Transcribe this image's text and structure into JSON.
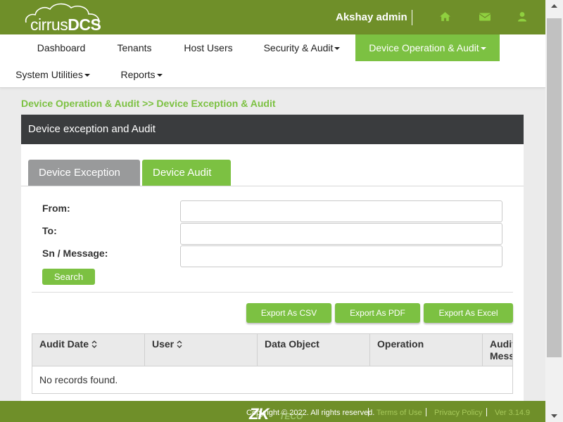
{
  "header": {
    "logo_light": "cirrus",
    "logo_bold": "DCS",
    "user_name": "Akshay admin",
    "icons": [
      "home-icon",
      "envelope-icon",
      "user-icon"
    ]
  },
  "nav": {
    "items": [
      {
        "label": "Dashboard"
      },
      {
        "label": "Tenants"
      },
      {
        "label": "Host Users"
      },
      {
        "label": "Security & Audit"
      },
      {
        "label": "Device Operation & Audit"
      },
      {
        "label": "System Utilities"
      },
      {
        "label": "Reports"
      }
    ],
    "active": "Device Operation & Audit"
  },
  "breadcrumb": "Device Operation & Audit >> Device Exception & Audit",
  "panel": {
    "title": "Device exception and Audit",
    "tabs": [
      {
        "label": "Device Exception"
      },
      {
        "label": "Device Audit"
      }
    ],
    "active_tab": "Device Audit"
  },
  "form": {
    "from_label": "From:",
    "from_value": "",
    "to_label": "To:",
    "to_value": "",
    "sn_label": "Sn / Message:",
    "sn_value": "",
    "search_label": "Search"
  },
  "export": {
    "csv": "Export As CSV",
    "pdf": "Export As PDF",
    "excel": "Export As Excel"
  },
  "table": {
    "columns": [
      "Audit Date",
      "User",
      "Data Object",
      "Operation",
      "Audit Mess"
    ],
    "columns_display": {
      "c4a": "Audit",
      "c4b": "Mess"
    },
    "empty_text": "No records found."
  },
  "footer": {
    "brand_zk": "ZK",
    "brand_teco": "TECO",
    "copyright": "Copyright © 2022. All rights reserved.",
    "terms": "Terms of Use",
    "privacy": "Privacy Policy",
    "version": "Ver 3.14.9"
  },
  "colors": {
    "brand_green": "#6f8f29",
    "accent_green": "#7cc142",
    "panel_dark": "#3a3c3e",
    "tab_grey": "#999a9b"
  }
}
